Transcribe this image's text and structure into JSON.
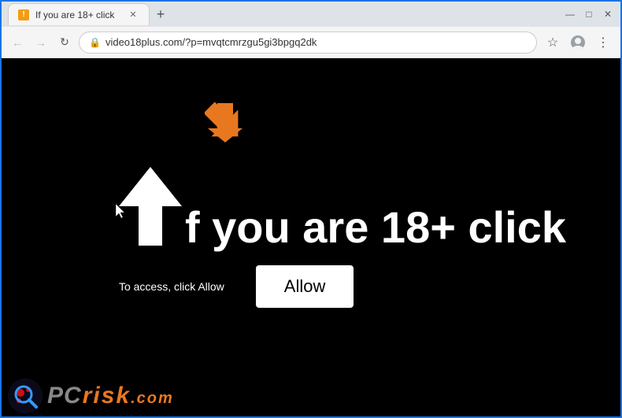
{
  "browser": {
    "tab": {
      "title": "If you are 18+ click",
      "favicon": "!"
    },
    "address": "video18plus.com/?p=mvqtcmrzgu5gi3bpgq2dk",
    "window_controls": {
      "minimize": "—",
      "maximize": "□",
      "close": "✕"
    },
    "nav": {
      "back": "←",
      "forward": "→",
      "refresh": "↻"
    },
    "toolbar": {
      "bookmark": "☆",
      "avatar": "○",
      "menu": "⋮"
    }
  },
  "page": {
    "main_text": "f you are 18+ click",
    "subtitle": "To access, click Allow",
    "allow_button_label": "Allow"
  },
  "watermark": {
    "logo_text_pc": "PC",
    "logo_text_risk": "risk",
    "logo_text_domain": ".com"
  }
}
